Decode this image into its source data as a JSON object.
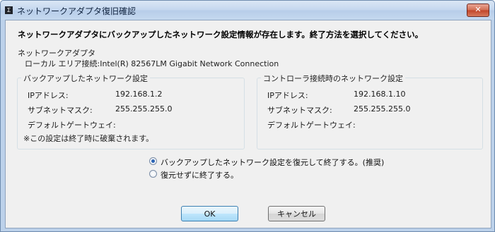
{
  "window": {
    "title": "ネットワークアダプタ復旧確認",
    "app_icon": "Σ",
    "close_glyph": "✕"
  },
  "message": "ネットワークアダプタにバックアップしたネットワーク設定情報が存在します。終了方法を選択してください。",
  "adapter": {
    "label": "ネットワークアダプタ",
    "value": "ローカル エリア接続:Intel(R) 82567LM Gigabit Network Connection"
  },
  "backup_group": {
    "title": "バックアップしたネットワーク設定",
    "rows": [
      {
        "key": "IPアドレス:",
        "value": "192.168.1.2"
      },
      {
        "key": "サブネットマスク:",
        "value": "255.255.255.0"
      },
      {
        "key": "デフォルトゲートウェイ:",
        "value": ""
      }
    ],
    "note": "※この設定は終了時に破棄されます。"
  },
  "controller_group": {
    "title": "コントローラ接続時のネットワーク設定",
    "rows": [
      {
        "key": "IPアドレス:",
        "value": "192.168.1.10"
      },
      {
        "key": "サブネットマスク:",
        "value": "255.255.255.0"
      },
      {
        "key": "デフォルトゲートウェイ:",
        "value": ""
      }
    ]
  },
  "options": [
    {
      "label": "バックアップしたネットワーク設定を復元して終了する。(推奨)",
      "selected": true
    },
    {
      "label": "復元せずに終了する。",
      "selected": false
    }
  ],
  "buttons": {
    "ok": "OK",
    "cancel": "キャンセル"
  }
}
